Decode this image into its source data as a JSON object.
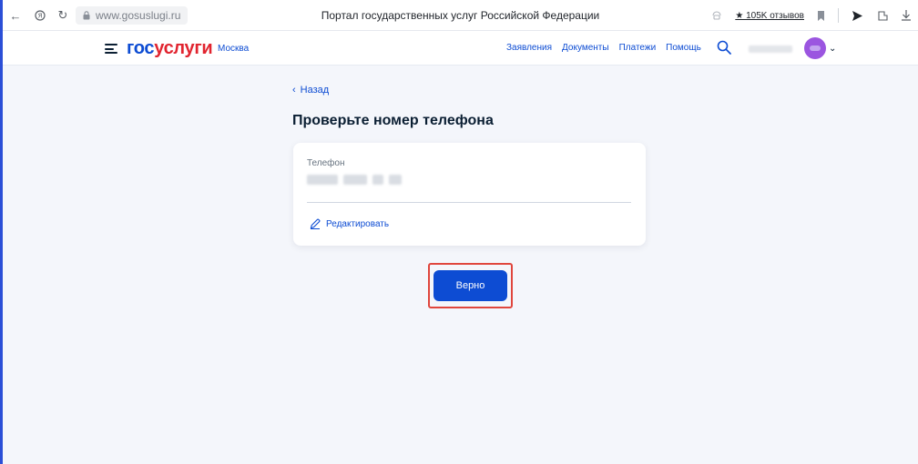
{
  "browser": {
    "url": "www.gosuslugi.ru",
    "title": "Портал государственных услуг Российской Федерации",
    "reviews": "★ 105K отзывов"
  },
  "header": {
    "logo_part1": "гос",
    "logo_part2": "услуги",
    "region": "Москва",
    "nav": [
      "Заявления",
      "Документы",
      "Платежи",
      "Помощь"
    ]
  },
  "main": {
    "back": "Назад",
    "title": "Проверьте номер телефона",
    "phone_label": "Телефон",
    "edit": "Редактировать",
    "confirm": "Верно"
  },
  "colors": {
    "accent": "#0d4cd3",
    "logo_red": "#e1242f",
    "highlight": "#e0463d",
    "avatar": "#9b55e0"
  }
}
